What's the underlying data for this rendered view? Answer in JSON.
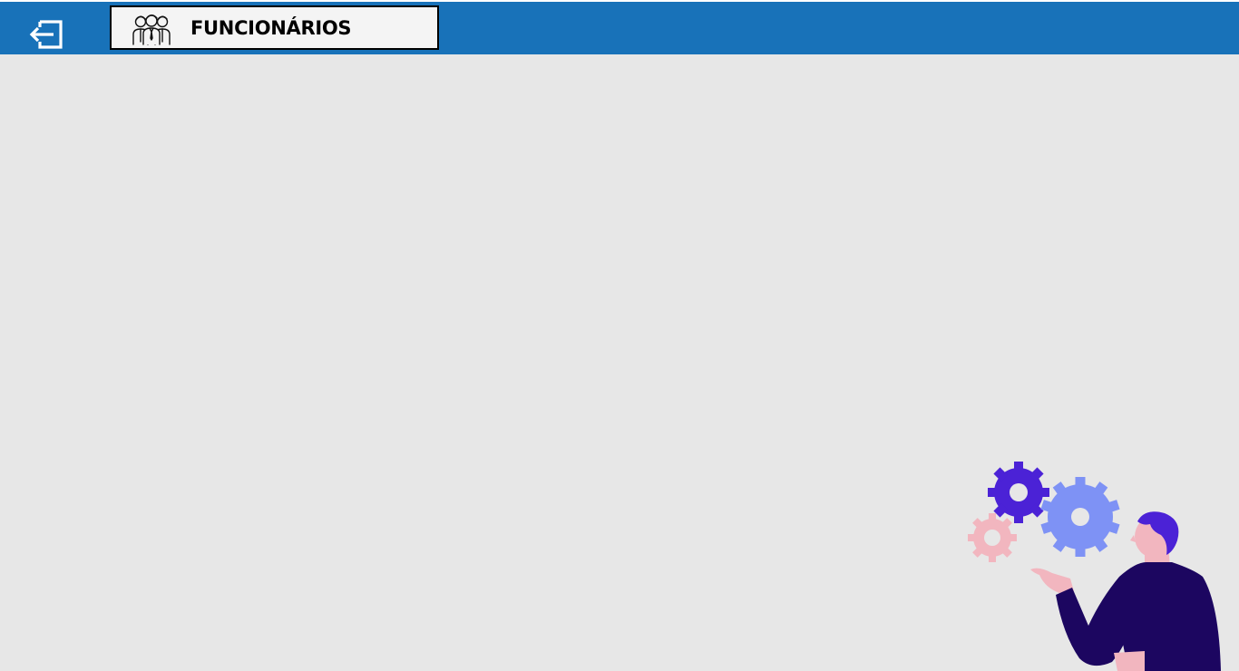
{
  "header": {
    "title": "FUNCIONÁRIOS",
    "exit_icon": "exit-icon",
    "title_icon": "employees-group-icon"
  },
  "colors": {
    "header_bg": "#1872b9",
    "content_bg": "#e7e7e7",
    "title_box_bg": "#f4f4f4",
    "gear_purple": "#4b22d6",
    "gear_light_blue": "#7e92f5",
    "gear_pink": "#f2b6bf",
    "person_navy": "#1c0660",
    "person_skin": "#f2b6bf"
  }
}
